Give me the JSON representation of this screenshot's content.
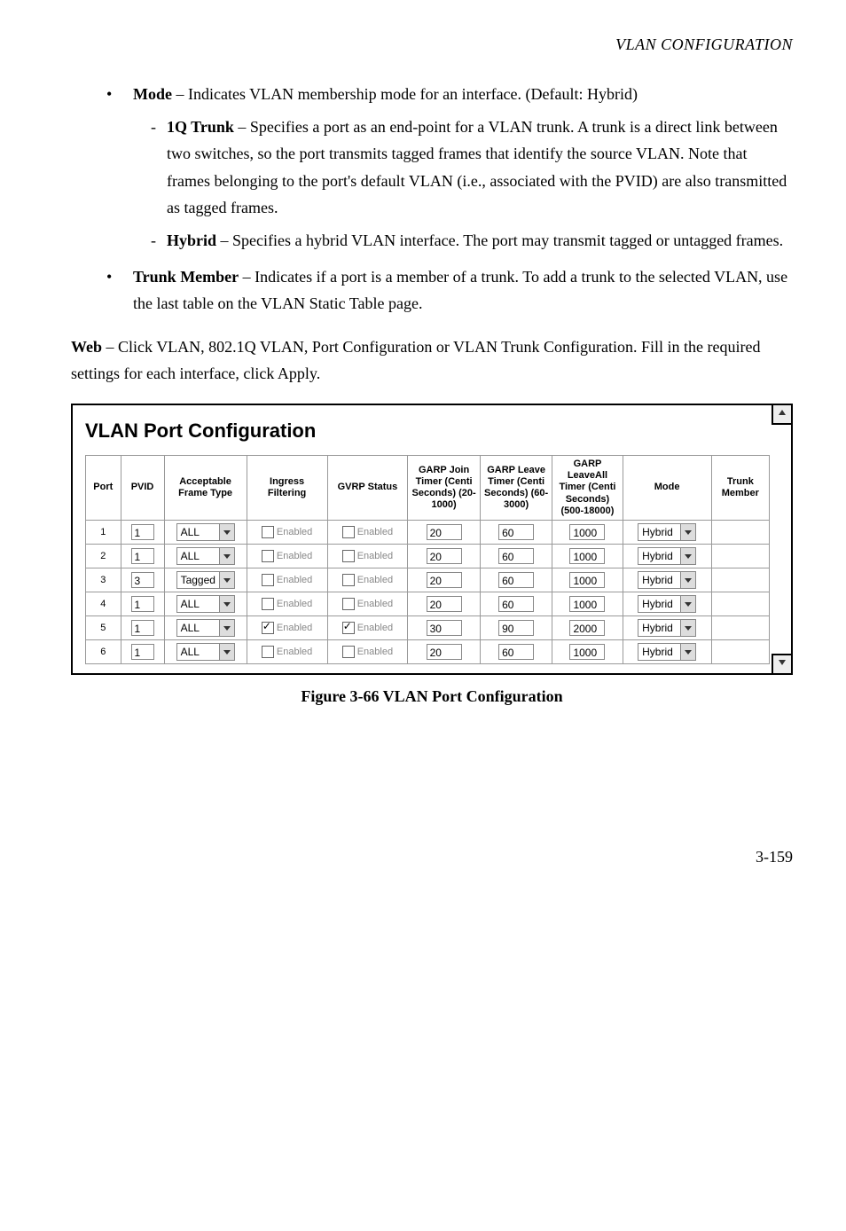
{
  "page_header": "VLAN CONFIGURATION",
  "bullets": [
    {
      "term": "Mode",
      "text": " – Indicates VLAN membership mode for an interface. (Default: Hybrid)",
      "sub": [
        {
          "term": "1Q Trunk",
          "text": " – Specifies a port as an end-point for a VLAN trunk. A trunk is a direct link between two switches, so the port transmits tagged frames that identify the source VLAN. Note that frames belonging to the port's default VLAN (i.e., associated with the PVID) are also transmitted as tagged frames."
        },
        {
          "term": "Hybrid",
          "text": " – Specifies a hybrid VLAN interface. The port may transmit tagged or untagged frames."
        }
      ]
    },
    {
      "term": "Trunk Member",
      "text": " – Indicates if a port is a member of a trunk. To add a trunk to the selected VLAN, use the last table on the VLAN Static Table page."
    }
  ],
  "web_prefix": "Web",
  "web_text": " – Click VLAN, 802.1Q VLAN, Port Configuration or VLAN Trunk Configuration. Fill in the required settings for each interface, click Apply.",
  "screenshot": {
    "title": "VLAN Port Configuration",
    "enabled_label": "Enabled",
    "headers": {
      "port": "Port",
      "pvid": "PVID",
      "frame_type": "Acceptable Frame Type",
      "ingress": "Ingress Filtering",
      "gvrp": "GVRP Status",
      "garp_join": "GARP Join Timer (Centi Seconds) (20-1000)",
      "garp_leave": "GARP Leave Timer (Centi Seconds) (60-3000)",
      "garp_leaveall": "GARP LeaveAll Timer (Centi Seconds) (500-18000)",
      "mode": "Mode",
      "trunk": "Trunk Member"
    },
    "rows": [
      {
        "port": "1",
        "pvid": "1",
        "frame_type": "ALL",
        "ingress": false,
        "gvrp": false,
        "join": "20",
        "leave": "60",
        "leaveall": "1000",
        "mode": "Hybrid"
      },
      {
        "port": "2",
        "pvid": "1",
        "frame_type": "ALL",
        "ingress": false,
        "gvrp": false,
        "join": "20",
        "leave": "60",
        "leaveall": "1000",
        "mode": "Hybrid"
      },
      {
        "port": "3",
        "pvid": "3",
        "frame_type": "Tagged",
        "ingress": false,
        "gvrp": false,
        "join": "20",
        "leave": "60",
        "leaveall": "1000",
        "mode": "Hybrid"
      },
      {
        "port": "4",
        "pvid": "1",
        "frame_type": "ALL",
        "ingress": false,
        "gvrp": false,
        "join": "20",
        "leave": "60",
        "leaveall": "1000",
        "mode": "Hybrid"
      },
      {
        "port": "5",
        "pvid": "1",
        "frame_type": "ALL",
        "ingress": true,
        "gvrp": true,
        "join": "30",
        "leave": "90",
        "leaveall": "2000",
        "mode": "Hybrid"
      },
      {
        "port": "6",
        "pvid": "1",
        "frame_type": "ALL",
        "ingress": false,
        "gvrp": false,
        "join": "20",
        "leave": "60",
        "leaveall": "1000",
        "mode": "Hybrid"
      }
    ]
  },
  "figure_caption": "Figure 3-66  VLAN Port Configuration",
  "page_number": "3-159"
}
